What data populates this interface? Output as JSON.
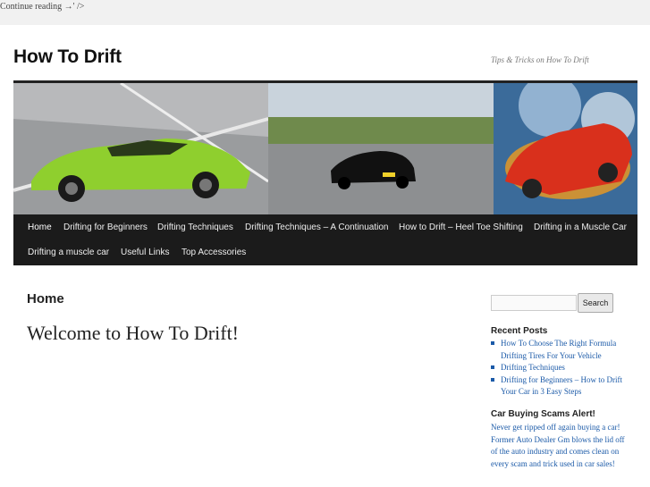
{
  "top_strip": {
    "text": "Continue reading →' />"
  },
  "header": {
    "site_title": "How To Drift",
    "site_description": "Tips & Tricks on How To Drift"
  },
  "nav": {
    "items": [
      {
        "label": "Home",
        "active": true
      },
      {
        "label": "Drifting for Beginners"
      },
      {
        "label": "Drifting Techniques"
      },
      {
        "label": "Drifting Techniques – A Continuation"
      },
      {
        "label": "How to Drift – Heel Toe Shifting"
      },
      {
        "label": "Drifting in a Muscle Car"
      },
      {
        "label": "Drifting a muscle car"
      },
      {
        "label": "Useful Links"
      },
      {
        "label": "Top Accessories"
      }
    ]
  },
  "main": {
    "page_heading": "Home",
    "welcome": "Welcome to How To Drift!"
  },
  "sidebar": {
    "search": {
      "placeholder": "",
      "button_label": "Search"
    },
    "recent_posts": {
      "title": "Recent Posts",
      "items": [
        {
          "label": "How To Choose The Right Formula Drifting Tires For Your Vehicle"
        },
        {
          "label": "Drifting Techniques"
        },
        {
          "label": "Drifting for Beginners – How to Drift Your Car in 3 Easy Steps"
        }
      ]
    },
    "scam_alert": {
      "title": "Car Buying Scams Alert!",
      "text": "Never get ripped off again buying a car! Former Auto Dealer Gm blows the lid off of the auto industry and comes clean on every scam and trick used in car sales!"
    }
  },
  "colors": {
    "nav_bg": "#1b1b1b",
    "link": "#1b5aa8",
    "accent_green_car": "#8fcf2e",
    "accent_red_car": "#d9301c"
  }
}
